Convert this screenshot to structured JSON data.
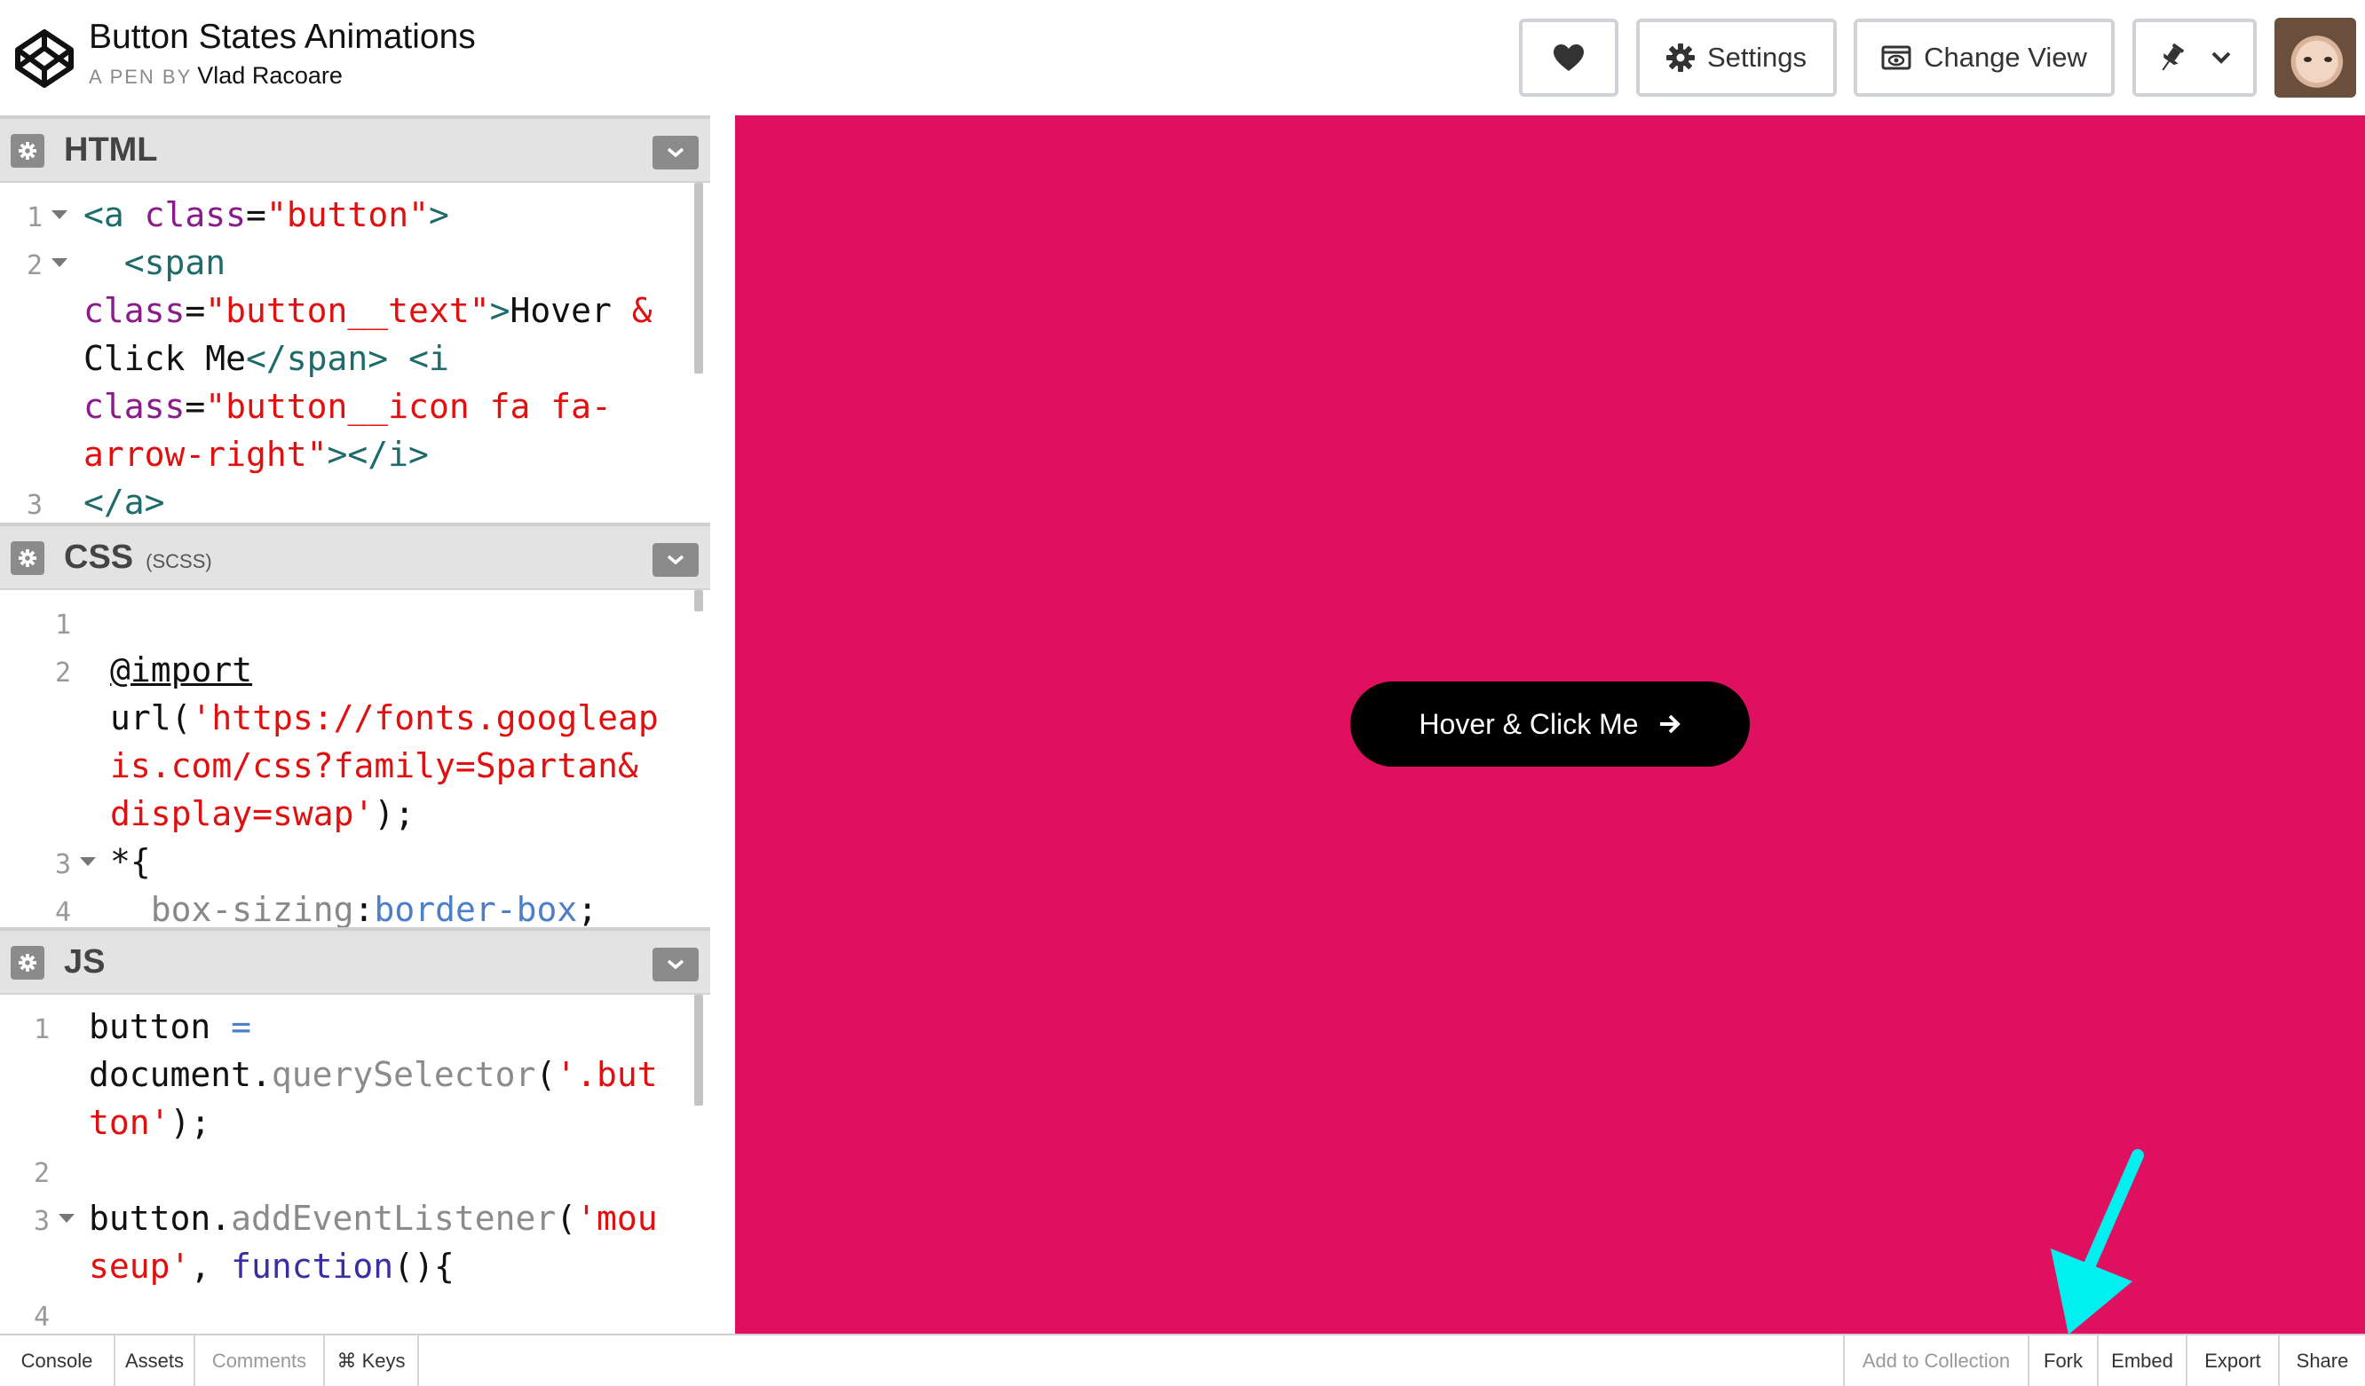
{
  "header": {
    "title": "Button States Animations",
    "byline_prefix": "A PEN BY",
    "author": "Vlad Racoare",
    "buttons": {
      "heart": "heart-icon",
      "settings": "Settings",
      "change_view": "Change View",
      "pin": "pin-icon"
    }
  },
  "panes": {
    "html": {
      "title": "HTML",
      "lines": [
        {
          "n": "1",
          "t": "<a class=\"button\">"
        },
        {
          "n": "2",
          "t": "  <span class=\"button__text\">Hover & Click Me</span> <i class=\"button__icon fa fa-arrow-right\"></i>"
        },
        {
          "n": "3",
          "t": "</a>"
        }
      ]
    },
    "css": {
      "title": "CSS",
      "subtitle": "(SCSS)",
      "lines": [
        {
          "n": "1",
          "t": ""
        },
        {
          "n": "2",
          "t": "@import url('https://fonts.googleapis.com/css?family=Spartan&display=swap');"
        },
        {
          "n": "3",
          "t": "*{"
        },
        {
          "n": "4",
          "t": "  box-sizing:border-box;"
        }
      ]
    },
    "js": {
      "title": "JS",
      "lines": [
        {
          "n": "1",
          "t": "button = document.querySelector('.button');"
        },
        {
          "n": "2",
          "t": ""
        },
        {
          "n": "3",
          "t": "button.addEventListener('mouseup', function(){"
        },
        {
          "n": "4",
          "t": ""
        }
      ]
    }
  },
  "preview": {
    "background": "#df1060",
    "button_label": "Hover & Click Me"
  },
  "footer": {
    "left": [
      "Console",
      "Assets",
      "Comments",
      "⌘ Keys"
    ],
    "right": [
      "Add to Collection",
      "Fork",
      "Embed",
      "Export",
      "Share"
    ]
  },
  "colors": {
    "annotation_arrow": "#00f0f0"
  }
}
